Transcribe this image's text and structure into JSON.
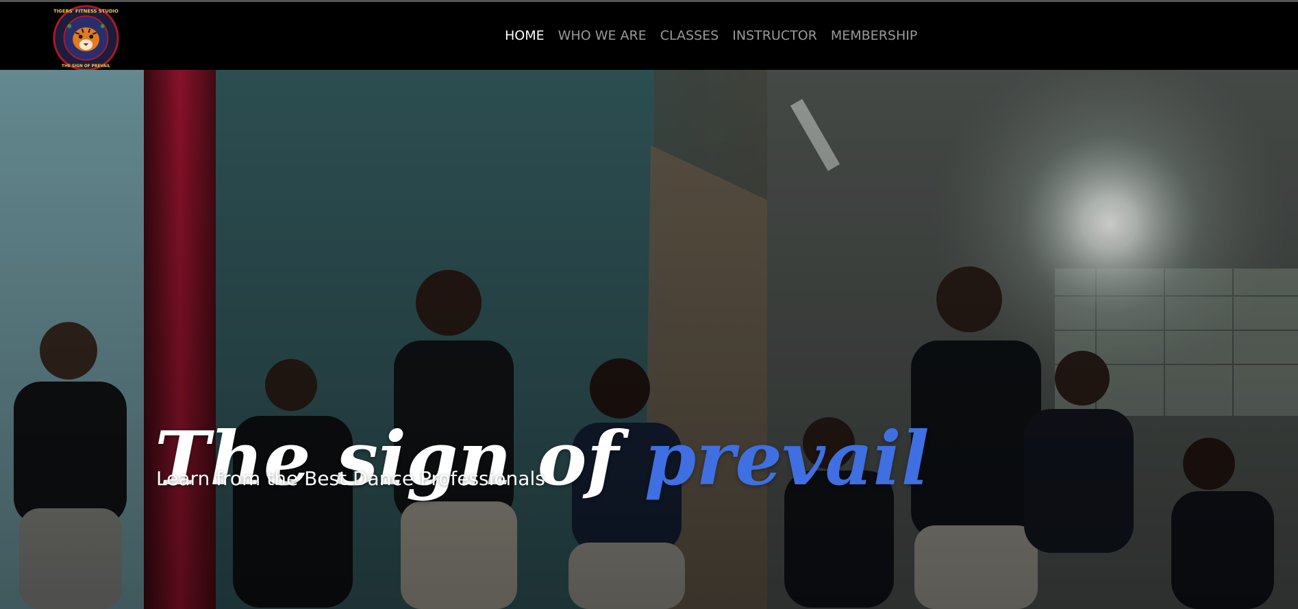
{
  "logo": {
    "top_text": "TIGERS' FITNESS STUDIO",
    "bottom_text": "THE SIGN OF PREVAIL",
    "icon": "tiger-face-icon"
  },
  "nav": {
    "items": [
      {
        "label": "HOME",
        "active": true
      },
      {
        "label": "WHO WE ARE",
        "active": false
      },
      {
        "label": "CLASSES",
        "active": false
      },
      {
        "label": "INSTRUCTOR",
        "active": false
      },
      {
        "label": "MEMBERSHIP",
        "active": false
      }
    ]
  },
  "hero": {
    "title_main": "The sign of",
    "title_accent": "prevail",
    "subtitle": "Learn from the Best Dance Professionals"
  },
  "colors": {
    "accent": "#3f6fe0",
    "nav_active": "#ffffff",
    "nav_inactive": "#9a9a9a",
    "navbar_bg": "#000000"
  }
}
